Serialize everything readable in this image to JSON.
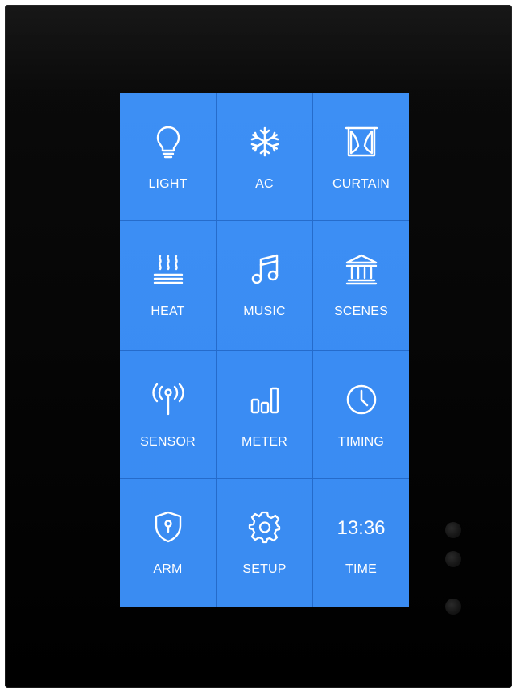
{
  "colors": {
    "screen_bg": "#3a8cf3",
    "tile_text": "#ffffff",
    "bezel": "#050505"
  },
  "tiles": [
    {
      "label": "LIGHT",
      "icon": "light-bulb-icon"
    },
    {
      "label": "AC",
      "icon": "snowflake-icon"
    },
    {
      "label": "CURTAIN",
      "icon": "curtain-icon"
    },
    {
      "label": "HEAT",
      "icon": "floor-heating-icon"
    },
    {
      "label": "MUSIC",
      "icon": "music-note-icon"
    },
    {
      "label": "SCENES",
      "icon": "building-columns-icon"
    },
    {
      "label": "SENSOR",
      "icon": "sensor-antenna-icon"
    },
    {
      "label": "METER",
      "icon": "bar-meter-icon"
    },
    {
      "label": "TIMING",
      "icon": "clock-icon"
    },
    {
      "label": "ARM",
      "icon": "shield-lock-icon"
    },
    {
      "label": "SETUP",
      "icon": "gear-icon"
    },
    {
      "label": "TIME",
      "icon": "time-display",
      "value": "13:36"
    }
  ]
}
